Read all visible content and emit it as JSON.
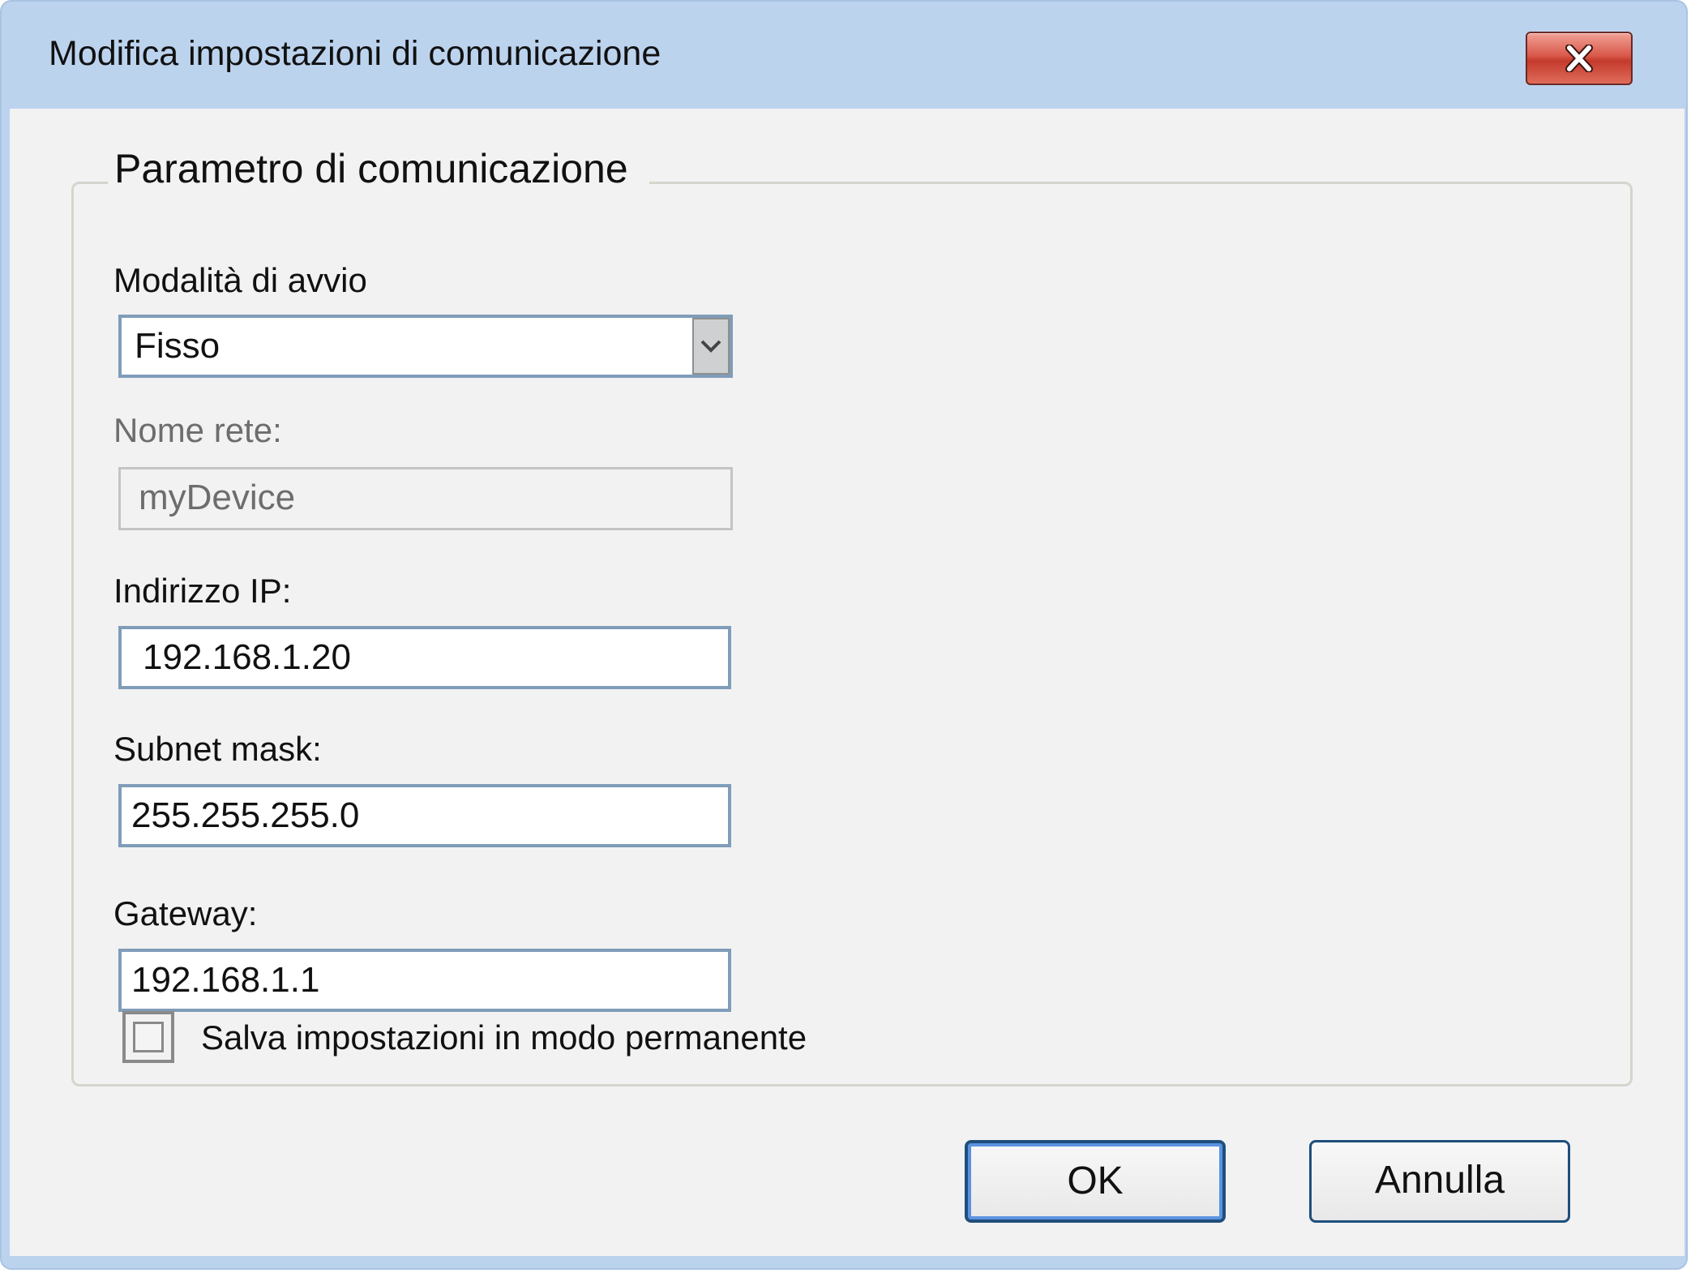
{
  "window": {
    "title": "Modifica impostazioni di comunicazione",
    "close_label": "X"
  },
  "group": {
    "legend": "Parametro di comunicazione"
  },
  "fields": {
    "start_mode_label": "Modalità di avvio",
    "start_mode_value": "Fisso",
    "network_name_label": "Nome rete:",
    "network_name_value": "myDevice",
    "ip_label": "Indirizzo IP:",
    "ip_value": "192.168.1.20",
    "subnet_label": "Subnet mask:",
    "subnet_value": "255.255.255.0",
    "gateway_label": "Gateway:",
    "gateway_value": "192.168.1.1"
  },
  "footer": {
    "save_permanent_label": "Salva impostazioni in modo permanente",
    "save_permanent_checked": false,
    "ok_label": "OK",
    "cancel_label": "Annulla"
  },
  "icons": {
    "close": "close-icon",
    "dropdown": "chevron-down-icon"
  }
}
